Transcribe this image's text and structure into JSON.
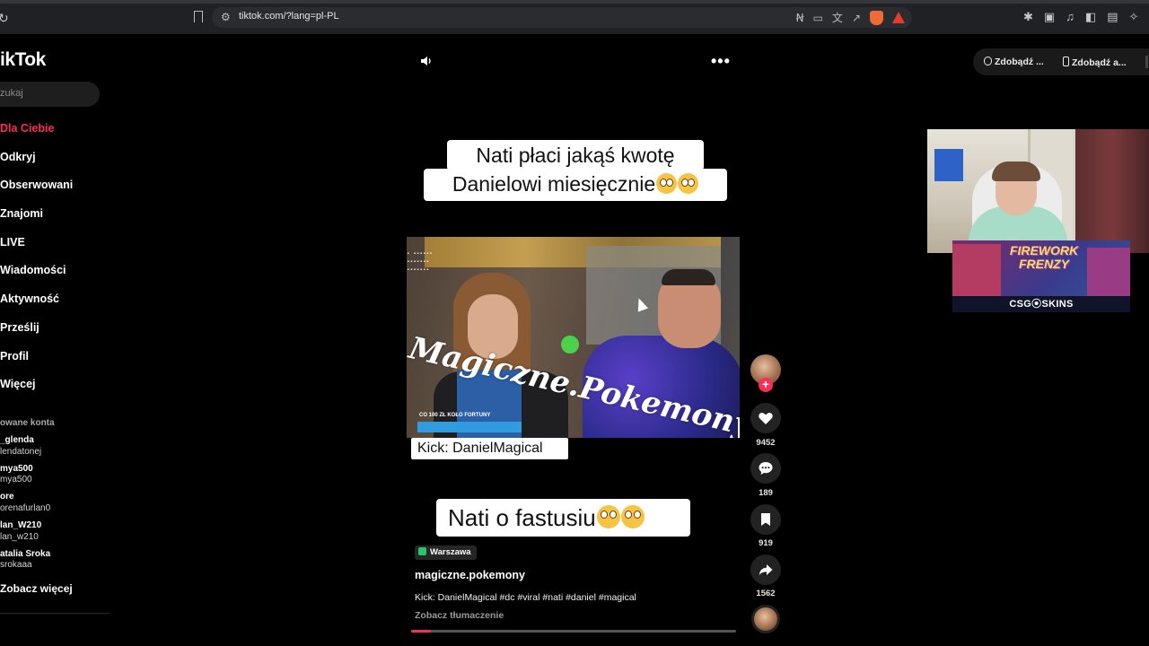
{
  "browser": {
    "url": "tiktok.com/?lang=pl-PL"
  },
  "sidebar": {
    "logo": "ikTok",
    "search_placeholder": "zukaj",
    "nav": [
      {
        "label": "Dla Ciebie",
        "active": true
      },
      {
        "label": "Odkryj"
      },
      {
        "label": "Obserwowani"
      },
      {
        "label": "Znajomi"
      },
      {
        "label": "LIVE"
      },
      {
        "label": "Wiadomości"
      },
      {
        "label": "Aktywność"
      },
      {
        "label": "Prześlij"
      },
      {
        "label": "Profil"
      },
      {
        "label": "Więcej"
      }
    ],
    "followed_title": "owane konta",
    "accounts": [
      {
        "name": "_glenda",
        "handle": "lendatonej"
      },
      {
        "name": "mya500",
        "handle": "mya500"
      },
      {
        "name": "ore",
        "handle": "orenafurlan0"
      },
      {
        "name": "lan_W210",
        "handle": "lan_w210"
      },
      {
        "name": "atalia Sroka",
        "handle": "srokaaa"
      }
    ],
    "see_more": "Zobacz więcej"
  },
  "top_pills": {
    "coins": "Zdobądź ...",
    "app": "Zdobądź a..."
  },
  "video": {
    "caption_top_line1": "Nati płaci jakąś kwotę",
    "caption_top_line2": "Danielowi miesięcznie",
    "watermark": "Magiczne.Pokemony",
    "fortuna_text": "CO 100 ZŁ KOŁO FORTUNY",
    "kick_label": "Kick: DanielMagical",
    "caption_bottom": "Nati o fastusiu",
    "location": "Warszawa",
    "author": "magiczne.pokemony",
    "description": "Kick: DanielMagical #dc #viral #nati #daniel #magical",
    "see_translation": "Zobacz tłumaczenie",
    "progress": 0.06
  },
  "actions": {
    "likes": "9452",
    "comments": "189",
    "saves": "919",
    "shares": "1562"
  },
  "overlay_ad": {
    "title": "FIREWORK FRENZY",
    "brand": "CSG⦿SKINS"
  },
  "colors": {
    "accent": "#fe2c55",
    "background": "#000000"
  }
}
